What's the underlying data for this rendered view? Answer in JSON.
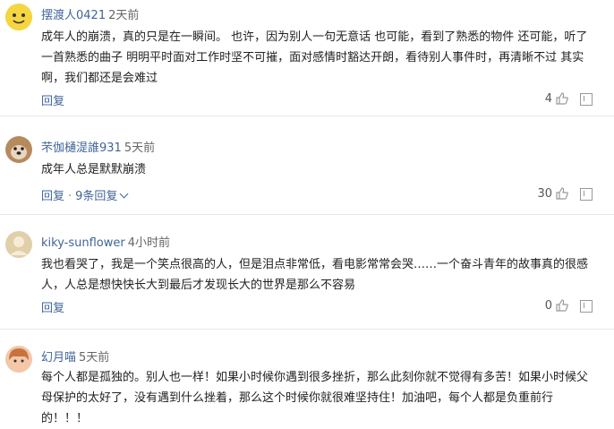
{
  "comments": [
    {
      "username": "摆渡人0421",
      "time": "2天前",
      "text": "成年人的崩溃，真的只是在一瞬间。 也许，因为别人一句无意话 也可能，看到了熟悉的物件 还可能，听了一首熟悉的曲子 明明平时面对工作时坚不可摧，面对感情时豁达开朗，看待别人事件时，再清晰不过 其实啊，我们都还是会难过",
      "reply_label": "回复",
      "more_replies": "",
      "likes": "4"
    },
    {
      "username": "芣伽樋湜誰931",
      "time": "5天前",
      "text": "成年人总是默默崩溃",
      "reply_label": "回复",
      "more_replies": "9条回复",
      "likes": "30"
    },
    {
      "username": "kiky-sunflower",
      "time": "4小时前",
      "text": "我也看哭了，我是一个笑点很高的人，但是泪点非常低，看电影常常会哭……一个奋斗青年的故事真的很感人，人总是想快快长大到最后才发现长大的世界是那么不容易",
      "reply_label": "回复",
      "more_replies": "",
      "likes": "0"
    },
    {
      "username": "幻月喵",
      "time": "5天前",
      "text": "每个人都是孤独的。别人也一样！如果小时候你遇到很多挫折，那么此刻你就不觉得有多苦！如果小时候父母保护的太好了，没有遇到什么挫着，那么这个时候你就很难坚持住！加油吧，每个人都是负重前行的！！！",
      "reply_label": "",
      "more_replies": "",
      "likes": ""
    }
  ],
  "colors": {
    "username": "#406599",
    "reply": "#406599",
    "text": "#222222",
    "time": "#666666"
  },
  "icons": {
    "like": "thumbs-up-icon",
    "report": "report-icon"
  }
}
